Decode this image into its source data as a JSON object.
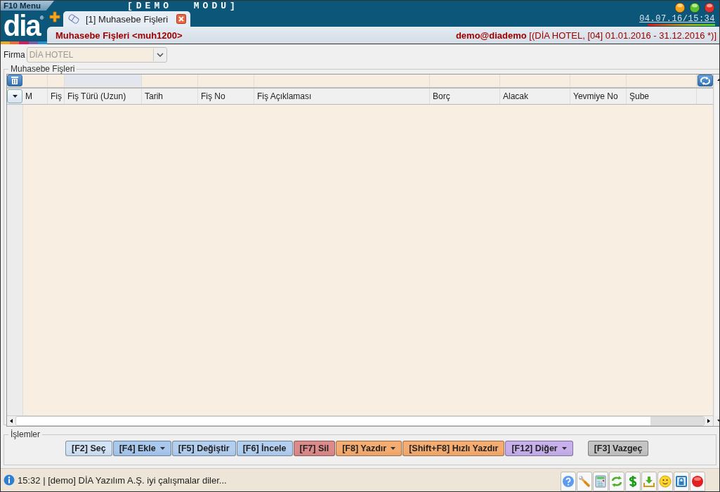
{
  "app": {
    "menu": "F10 Menu",
    "logo": "dia",
    "logo_mark": "®",
    "mode_banner": "[DEMO MODU]",
    "datetime": "04.07.16/15:34"
  },
  "tabs": [
    {
      "label": "[1] Muhasebe Fişleri",
      "selected": true
    }
  ],
  "header": {
    "title": "Muhasebe Fişleri <muh1200>",
    "user": "demo@diademo",
    "context": "[(DİA HOTEL, [04] 01.01.2016 - 31.12.2016 *)]"
  },
  "firma": {
    "label": "Firma",
    "value": "DİA HOTEL",
    "disabled": true
  },
  "list_panel": {
    "title": "Muhasebe Fişleri",
    "columns": [
      {
        "label": "M"
      },
      {
        "label": "Fiş"
      },
      {
        "label": "Fiş Türü (Uzun)"
      },
      {
        "label": "Tarih"
      },
      {
        "label": "Fiş No"
      },
      {
        "label": "Fiş Açıklaması"
      },
      {
        "label": "Borç"
      },
      {
        "label": "Alacak"
      },
      {
        "label": "Yevmiye No"
      },
      {
        "label": "Şube"
      }
    ]
  },
  "actions": {
    "title": "İşlemler",
    "buttons": [
      {
        "label": "[F2] Seç",
        "color": "#d2e3f5",
        "dropdown": false
      },
      {
        "label": "[F4] Ekle",
        "color": "#a8c8ee",
        "dropdown": true
      },
      {
        "label": "[F5] Değiştir",
        "color": "#b3cff0",
        "dropdown": false
      },
      {
        "label": "[F6] İncele",
        "color": "#b3cff0",
        "dropdown": false
      },
      {
        "label": "[F7] Sil",
        "color": "#dc8a8a",
        "dropdown": false
      },
      {
        "label": "[F8] Yazdır",
        "color": "#f5ac70",
        "dropdown": true
      },
      {
        "label": "[Shift+F8] Hızlı Yazdır",
        "color": "#f5ac70",
        "dropdown": false
      },
      {
        "label": "[F12] Diğer",
        "color": "#c7b0ec",
        "dropdown": true
      },
      {
        "label": "[F3] Vazgeç",
        "color": "#c4c4c4",
        "dropdown": false
      }
    ]
  },
  "status_bar": {
    "message": "15:32 | [demo] DİA Yazılım A.Ş. iyi çalışmalar diler..."
  }
}
